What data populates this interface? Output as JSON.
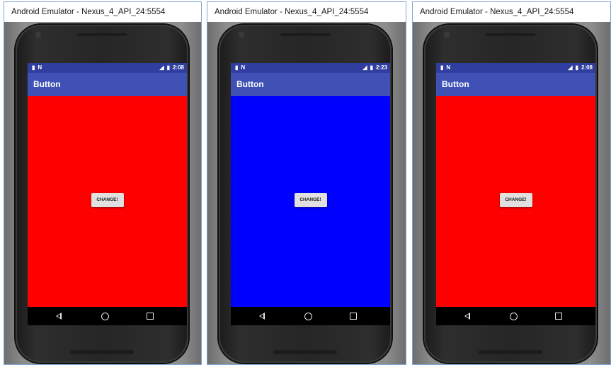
{
  "windows": [
    {
      "title": "Android Emulator - Nexus_4_API_24:5554",
      "status_left": "N",
      "time": "2:08",
      "app_title": "Button",
      "button_label": "CHANGE!",
      "background_color": "#ff0000"
    },
    {
      "title": "Android Emulator - Nexus_4_API_24:5554",
      "status_left": "N",
      "time": "2:23",
      "app_title": "Button",
      "button_label": "CHANGE!",
      "background_color": "#0000ff"
    },
    {
      "title": "Android Emulator - Nexus_4_API_24:5554",
      "status_left": "N",
      "time": "2:08",
      "app_title": "Button",
      "button_label": "CHANGE!",
      "background_color": "#ff0000"
    }
  ],
  "colors": {
    "status_bar": "#303f9f",
    "app_bar": "#3f51b5",
    "button_bg": "#e0e0e0"
  },
  "icons": {
    "status": [
      "sd-card-icon",
      "signal-icon",
      "battery-icon"
    ],
    "nav": [
      "back-icon",
      "home-icon",
      "recents-icon"
    ]
  }
}
